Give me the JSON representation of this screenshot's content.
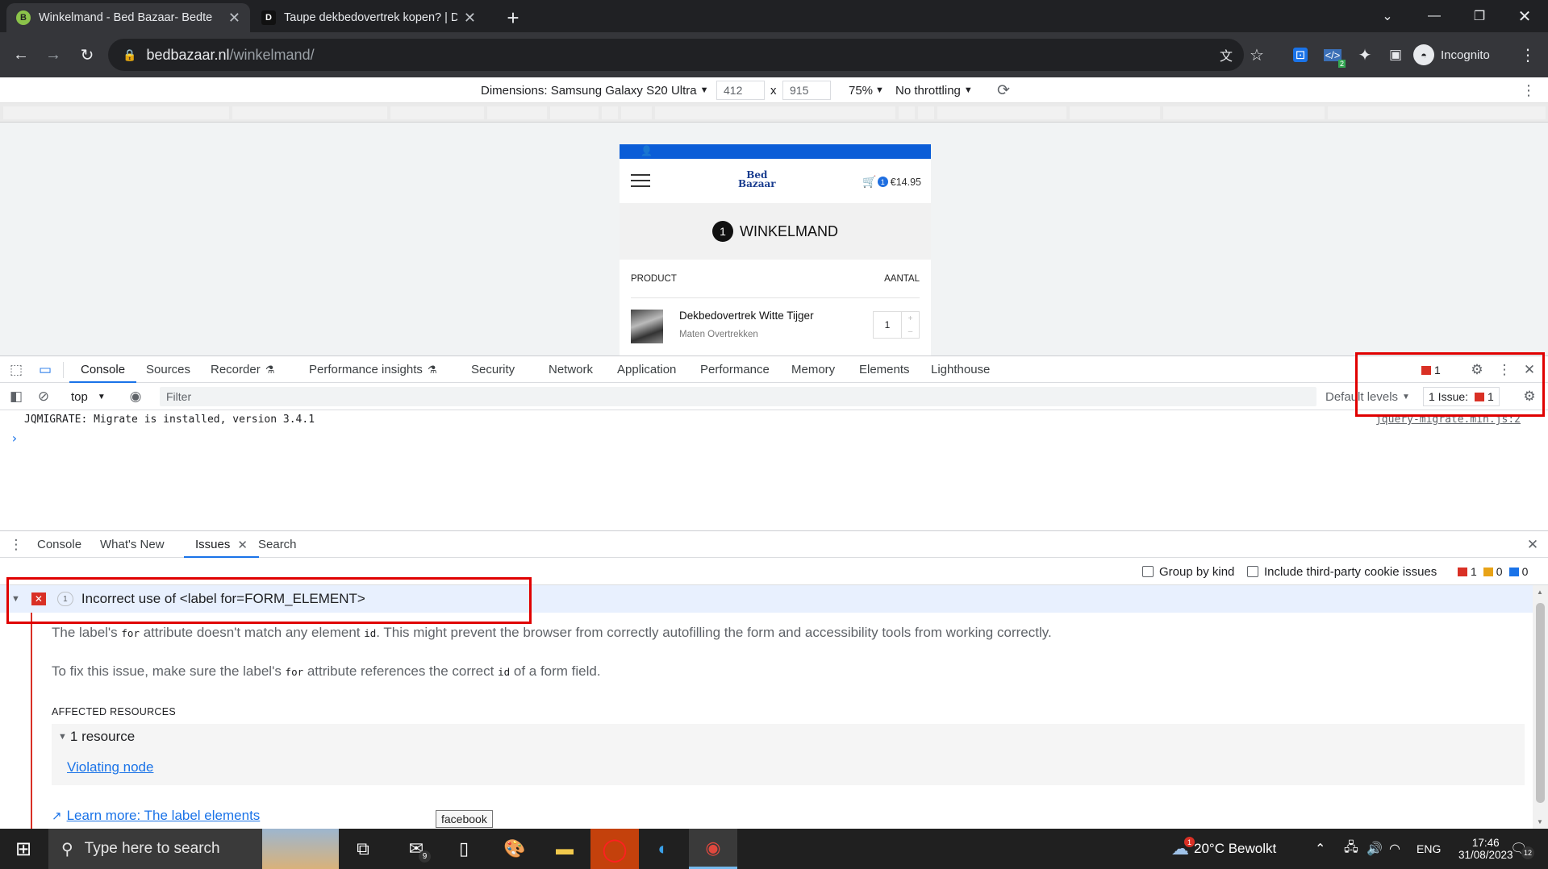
{
  "browser": {
    "tabs": [
      {
        "title": "Winkelmand - Bed Bazaar- Bedte",
        "active": true,
        "favicon": "B"
      },
      {
        "title": "Taupe dekbedovertrek kopen? | D",
        "active": false,
        "favicon": "D"
      }
    ],
    "url_host": "bedbazaar.nl",
    "url_path": "/winkelmand/",
    "profile_label": "Incognito",
    "extension_badge": "2"
  },
  "device_toolbar": {
    "dimensions_label": "Dimensions: Samsung Galaxy S20 Ultra",
    "width": "412",
    "times": "x",
    "height": "915",
    "zoom": "75%",
    "throttling": "No throttling"
  },
  "site": {
    "logo_line1": "Bed",
    "logo_line2": "Bazaar",
    "cart_count": "1",
    "cart_total": "€14.95",
    "page_title": "WINKELMAND",
    "page_title_count": "1",
    "col_product": "PRODUCT",
    "col_qty": "AANTAL",
    "product_name": "Dekbedovertrek Witte Tijger",
    "product_sub": "Maten Overtrekken",
    "product_qty": "1"
  },
  "devtools": {
    "tabs": [
      "Console",
      "Sources",
      "Recorder",
      "Performance insights",
      "Security",
      "Network",
      "Application",
      "Performance",
      "Memory",
      "Elements",
      "Lighthouse"
    ],
    "error_count": "1",
    "context": "top",
    "filter_placeholder": "Filter",
    "levels": "Default levels",
    "issues_label": "1 Issue:",
    "issues_count": "1",
    "log_message": "JQMIGRATE: Migrate is installed, version 3.4.1",
    "log_source": "jquery-migrate.min.js:2"
  },
  "drawer": {
    "tabs": [
      "Console",
      "What's New",
      "Issues",
      "Search"
    ],
    "group_by_kind": "Group by kind",
    "third_party": "Include third-party cookie issues",
    "errors": "1",
    "warnings": "0",
    "infos": "0"
  },
  "issue": {
    "count": "1",
    "title": "Incorrect use of <label for=FORM_ELEMENT>",
    "desc_a": "The label's ",
    "desc_code1": "for",
    "desc_b": " attribute doesn't match any element ",
    "desc_code2": "id",
    "desc_c": ". This might prevent the browser from correctly autofilling the form and accessibility tools from working correctly.",
    "fix_a": "To fix this issue, make sure the label's ",
    "fix_code1": "for",
    "fix_b": " attribute references the correct ",
    "fix_code2": "id",
    "fix_c": " of a form field.",
    "affected_heading": "AFFECTED RESOURCES",
    "resource_count": "1 resource",
    "violating_node": "Violating node",
    "learn_more": "Learn more: The label elements"
  },
  "tooltip": "facebook",
  "taskbar": {
    "search_placeholder": "Type here to search",
    "mail_badge": "9",
    "weather": "20°C Bewolkt",
    "weather_badge": "1",
    "language": "ENG",
    "time": "17:46",
    "date": "31/08/2023",
    "notif_count": "12"
  }
}
